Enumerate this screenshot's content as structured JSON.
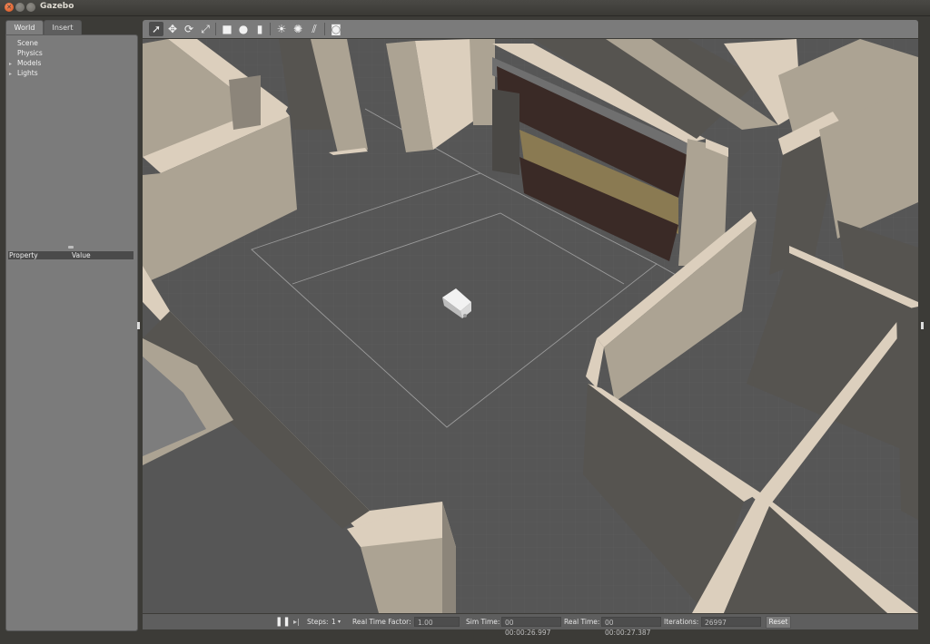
{
  "window": {
    "title": "Gazebo"
  },
  "left_panel": {
    "tabs": [
      {
        "label": "World"
      },
      {
        "label": "Insert"
      }
    ],
    "tree": [
      {
        "label": "Scene"
      },
      {
        "label": "Physics"
      },
      {
        "label": "Models"
      },
      {
        "label": "Lights"
      }
    ],
    "properties": {
      "col_property": "Property",
      "col_value": "Value"
    }
  },
  "toolbar": {
    "icons": [
      "select-arrow-icon",
      "translate-icon",
      "rotate-icon",
      "scale-icon",
      "box-icon",
      "sphere-icon",
      "cylinder-icon",
      "point-light-icon",
      "spot-light-icon",
      "directional-light-icon",
      "screenshot-icon"
    ]
  },
  "bottom_bar": {
    "steps_label": "Steps:",
    "steps_value": "1",
    "rtf_label": "Real Time Factor:",
    "rtf_value": "1.00",
    "sim_time_label": "Sim Time:",
    "sim_time_value": "00 00:00:26.997",
    "real_time_label": "Real Time:",
    "real_time_value": "00 00:00:27.387",
    "iterations_label": "Iterations:",
    "iterations_value": "26997",
    "reset_label": "Reset"
  },
  "colors": {
    "wall_top": "#dccfbd",
    "wall_side": "#aca393",
    "wall_dark": "#565450",
    "floor": "#565656",
    "cabinet": "#3a2a26",
    "counter": "#8a7a52"
  }
}
